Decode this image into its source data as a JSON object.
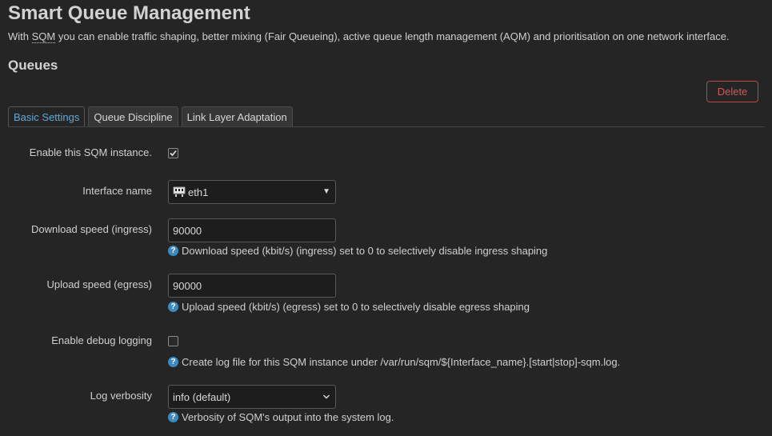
{
  "header": {
    "title": "Smart Queue Management",
    "intro_prefix": "With ",
    "intro_abbr": "SQM",
    "intro_suffix": " you can enable traffic shaping, better mixing (Fair Queueing), active queue length management (AQM) and prioritisation on one network interface."
  },
  "section": {
    "title": "Queues",
    "delete_label": "Delete"
  },
  "tabs": [
    {
      "label": "Basic Settings",
      "active": true
    },
    {
      "label": "Queue Discipline",
      "active": false
    },
    {
      "label": "Link Layer Adaptation",
      "active": false
    }
  ],
  "form": {
    "enable": {
      "label": "Enable this SQM instance.",
      "checked": true
    },
    "interface": {
      "label": "Interface name",
      "value": "eth1",
      "icon": "ethernet-port-icon"
    },
    "download": {
      "label": "Download speed (ingress)",
      "value": "90000",
      "help": "Download speed (kbit/s) (ingress) set to 0 to selectively disable ingress shaping"
    },
    "upload": {
      "label": "Upload speed (egress)",
      "value": "90000",
      "help": "Upload speed (kbit/s) (egress) set to 0 to selectively disable egress shaping"
    },
    "debug": {
      "label": "Enable debug logging",
      "checked": false,
      "help": "Create log file for this SQM instance under /var/run/sqm/${Interface_name}.[start|stop]-sqm.log."
    },
    "verbosity": {
      "label": "Log verbosity",
      "value": "info (default)",
      "help": "Verbosity of SQM's output into the system log."
    }
  },
  "colors": {
    "background": "#252525",
    "accent": "#5fa9d8",
    "danger": "#c85c5c",
    "help_icon": "#3b8bc2"
  }
}
